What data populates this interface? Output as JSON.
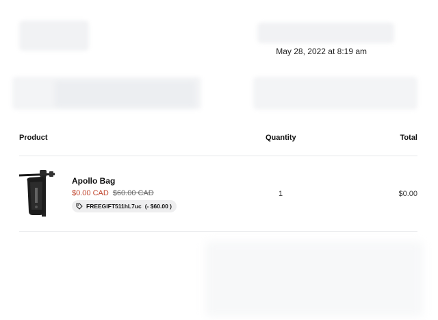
{
  "order": {
    "date": "May 28, 2022 at 8:19 am"
  },
  "table": {
    "headers": {
      "product": "Product",
      "quantity": "Quantity",
      "total": "Total"
    },
    "items": [
      {
        "name": "Apollo Bag",
        "price": "$0.00 CAD",
        "compare_price": "$60.00 CAD",
        "discount_code": "FREEGIFT511hL7uc",
        "discount_amount": "(- $60.00 )",
        "quantity": "1",
        "total": "$0.00",
        "thumbnail_icon": "scooter-bag-thumbnail"
      }
    ]
  },
  "colors": {
    "sale_price": "#c0432b",
    "divider": "#e6e7ea"
  }
}
